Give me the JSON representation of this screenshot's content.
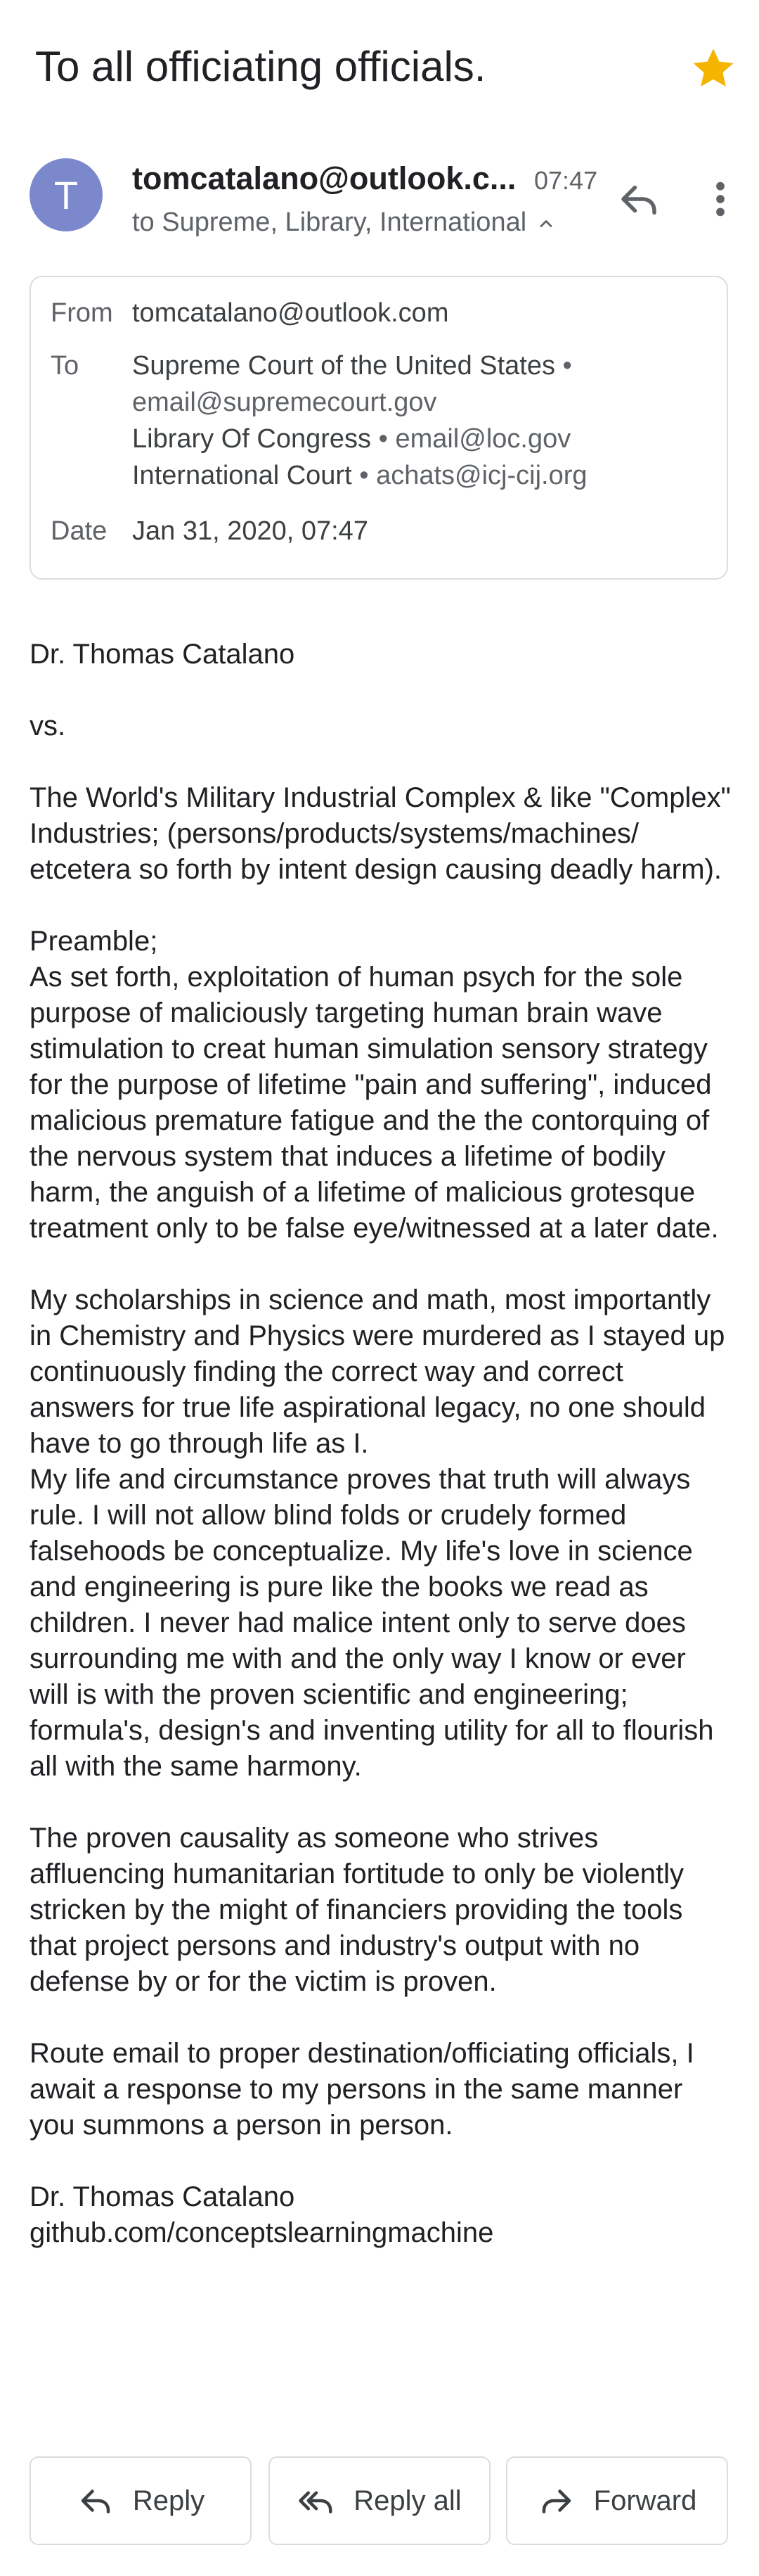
{
  "subject": "To all officiating officials.",
  "starred": true,
  "colors": {
    "star": "#f4b400",
    "avatar_bg": "#7b88cc"
  },
  "sender": {
    "avatar_letter": "T",
    "name": "tomcatalano@outlook.c...",
    "time": "07:47",
    "recipients_summary": "to Supreme, Library, International"
  },
  "details": {
    "from_label": "From",
    "from_value": "tomcatalano@outlook.com",
    "to_label": "To",
    "to_entries": [
      {
        "name": "Supreme Court of the United States",
        "separator": " •",
        "email": "email@supremecourt.gov"
      },
      {
        "name": "Library Of Congress",
        "separator": " • ",
        "email": "email@loc.gov"
      },
      {
        "name": "International Court",
        "separator": " • ",
        "email": "achats@icj-cij.org"
      }
    ],
    "date_label": "Date",
    "date_value": "Jan 31, 2020, 07:47"
  },
  "body": "Dr. Thomas Catalano\n\nvs.\n\nThe World's Military Industrial Complex & like \"Complex\" Industries; (persons/products/systems/machines/ etcetera so forth by intent design causing deadly harm).\n\nPreamble;\nAs set forth, exploitation of human psych for the sole purpose of maliciously targeting human brain wave stimulation to creat human simulation sensory strategy for the purpose of lifetime \"pain and suffering\", induced malicious premature fatigue and the the contorquing of the nervous system that induces a lifetime of bodily harm, the anguish of a lifetime of malicious grotesque treatment only to be false eye/witnessed at a later date.\n\nMy scholarships in science and math, most importantly in Chemistry and Physics were murdered as I stayed up continuously finding the correct way and correct answers for true life aspirational legacy, no one should have to go through life as I.\nMy life and circumstance proves that truth will always rule. I will not allow blind folds or crudely formed falsehoods be conceptualize. My life's love in science and engineering is pure like the books we read as children. I never had malice intent only to serve does surrounding me with and the only way I know or ever will is with the proven scientific and engineering; formula's, design's and inventing utility for all to flourish all with the same harmony.\n\nThe proven causality as someone who strives affluencing humanitarian fortitude to only be violently stricken by the might of financiers providing the tools that project persons and industry's output with no defense by or for the victim is proven.\n\nRoute email to proper destination/officiating officials, I await a response to my persons in the same manner you summons a person in person.\n\nDr. Thomas Catalano\ngithub.com/conceptslearningmachine",
  "actions": {
    "reply": "Reply",
    "reply_all": "Reply all",
    "forward": "Forward"
  }
}
